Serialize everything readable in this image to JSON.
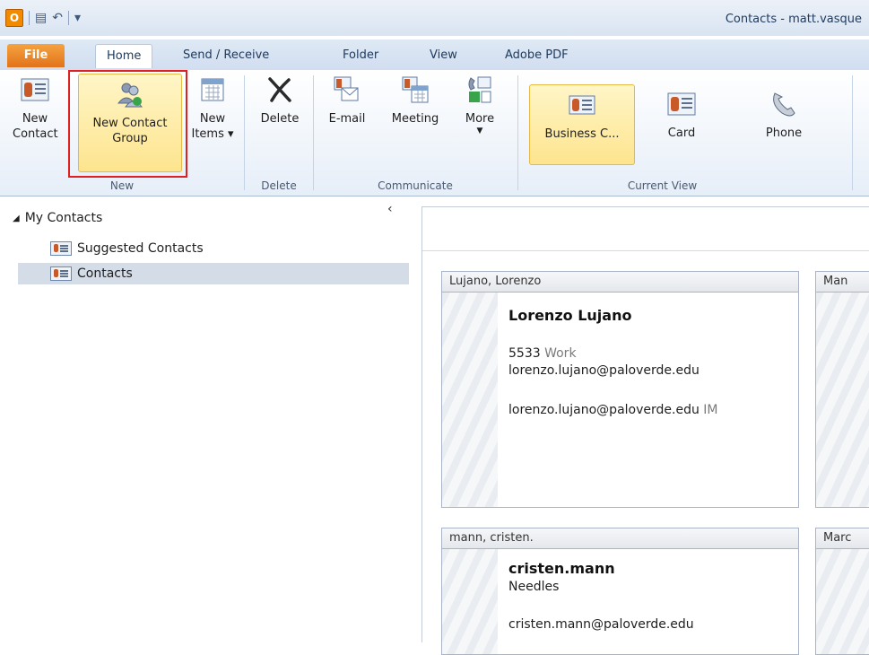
{
  "window": {
    "title": "Contacts - matt.vasque",
    "app_icon_letter": "O"
  },
  "tabs": [
    {
      "label": "File"
    },
    {
      "label": "Home"
    },
    {
      "label": "Send / Receive"
    },
    {
      "label": "Folder"
    },
    {
      "label": "View"
    },
    {
      "label": "Adobe PDF"
    }
  ],
  "ribbon": {
    "new_group": {
      "label": "New",
      "new_contact": "New Contact",
      "new_contact_group": "New Contact Group",
      "new_items": "New Items ▾"
    },
    "delete_group": {
      "label": "Delete",
      "delete": "Delete"
    },
    "communicate_group": {
      "label": "Communicate",
      "email": "E-mail",
      "meeting": "Meeting",
      "more": "More"
    },
    "current_view_group": {
      "label": "Current View",
      "business_card": "Business C...",
      "card": "Card",
      "phone": "Phone"
    }
  },
  "nav": {
    "root": "My Contacts",
    "items": [
      {
        "label": "Suggested Contacts"
      },
      {
        "label": "Contacts"
      }
    ]
  },
  "cards": [
    {
      "header": "Lujano, Lorenzo",
      "name": "Lorenzo Lujano",
      "phone": "5533",
      "phone_type": "Work",
      "email": "lorenzo.lujano@paloverde.edu",
      "im": "lorenzo.lujano@paloverde.edu",
      "im_label": "IM"
    },
    {
      "header": "mann, cristen.",
      "name": "cristen.mann",
      "company": "Needles",
      "email": "cristen.mann@paloverde.edu"
    }
  ],
  "partial_cards": [
    {
      "header": "Man"
    },
    {
      "header": "Marc"
    }
  ],
  "colors": {
    "accent_file_tab": "#e2721b",
    "highlight": "#fde48e",
    "annotation_box": "#e02020"
  }
}
